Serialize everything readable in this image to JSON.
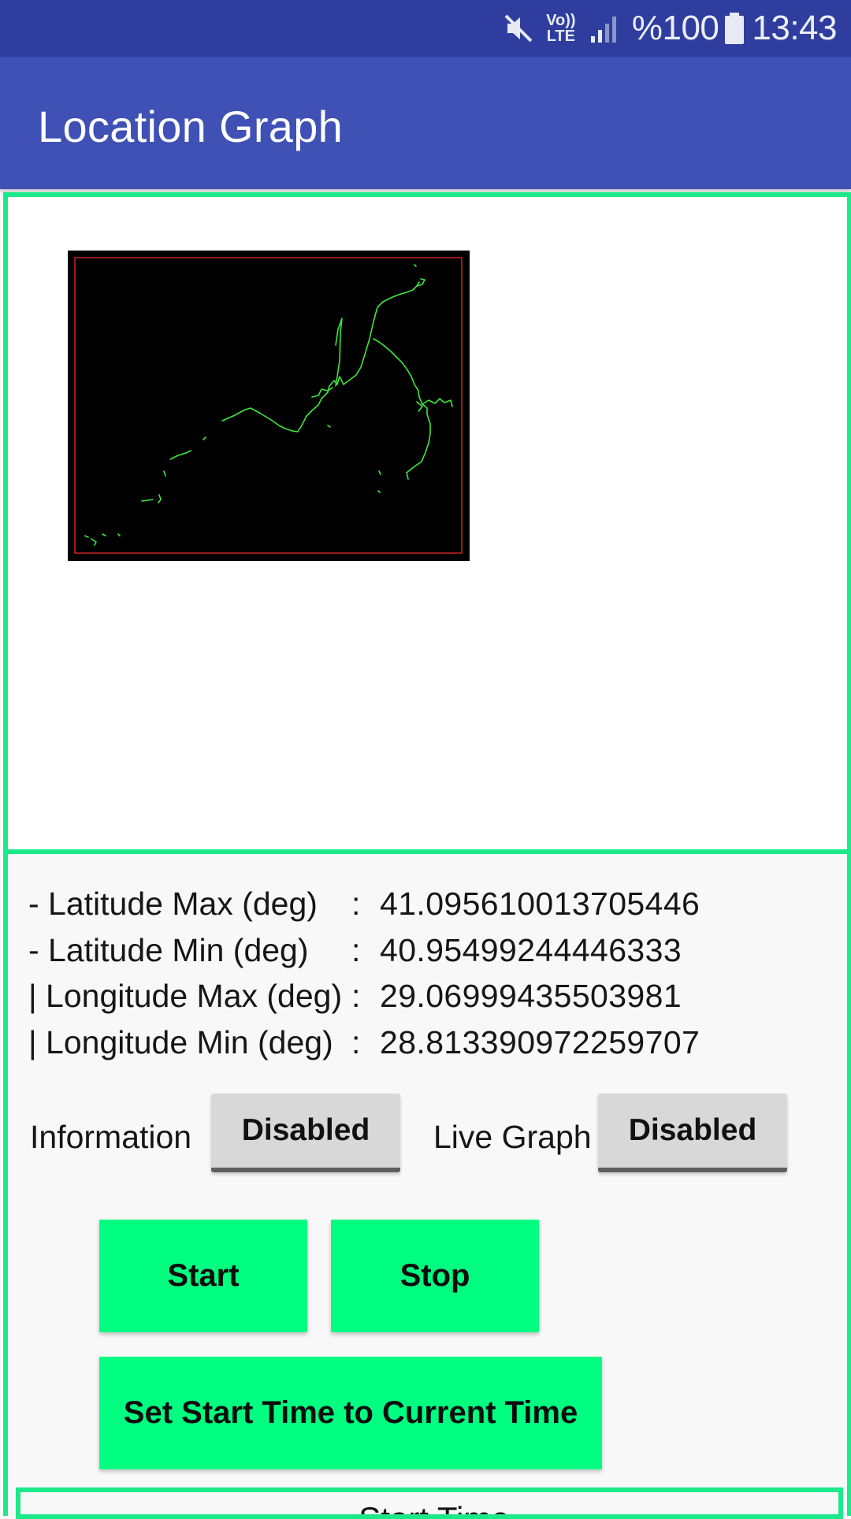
{
  "status_bar": {
    "icons": [
      "mute-icon",
      "volte-icon",
      "signal-icon",
      "battery-icon"
    ],
    "volte_text": "Vo)) LTE",
    "battery": "%100",
    "time": "13:43"
  },
  "app_bar": {
    "title": "Location Graph"
  },
  "graph": {
    "background_color": "#000000",
    "frame_color": "#cc2222",
    "track_color": "#3de83d"
  },
  "stats": {
    "lat_max_label": "- Latitude Max (deg)",
    "lat_max_value": "41.095610013705446",
    "lat_min_label": "- Latitude Min (deg)",
    "lat_min_value": "40.95499244446333",
    "lon_max_label": "| Longitude Max (deg)",
    "lon_max_value": "29.06999435503981",
    "lon_min_label": "| Longitude Min (deg)",
    "lon_min_value": "28.813390972259707",
    "separator": ":"
  },
  "toggles": {
    "information_label": "Information",
    "information_state": "Disabled",
    "live_graph_label": "Live Graph",
    "live_graph_state": "Disabled"
  },
  "buttons": {
    "start": "Start",
    "stop": "Stop",
    "set_start_time": "Set Start Time to Current Time"
  },
  "bottom": {
    "text": "Start Time"
  },
  "colors": {
    "status_bar": "#2f3e9e",
    "app_bar": "#3f51b5",
    "panel_border": "#1de98b",
    "action_button": "#00fe80",
    "toggle_button": "#d8d8d8"
  }
}
